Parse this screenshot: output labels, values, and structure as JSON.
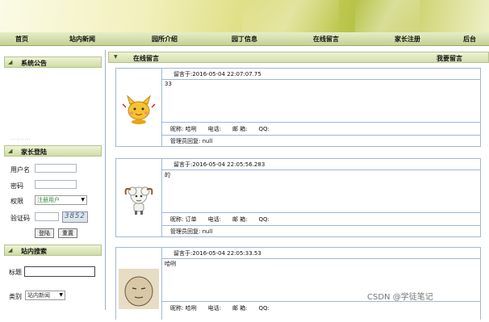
{
  "nav": {
    "items": [
      "首页",
      "站内新闻",
      "园所介绍",
      "园丁信息",
      "在线留言",
      "家长注册",
      "后台"
    ]
  },
  "sidebar": {
    "announcement_title": "系统公告",
    "announcement_text": "· · · · · · · · · ·",
    "login_title": "家长登陆",
    "username_label": "用户名",
    "password_label": "密码",
    "role_label": "权限",
    "role_value": "注册用户",
    "captcha_label": "验证码",
    "captcha_text": "3852",
    "login_button": "登陆",
    "reset_button": "重置",
    "search_title": "站内搜索",
    "search_label": "标题",
    "category_label": "类别",
    "category_value": "站内新闻"
  },
  "main": {
    "title": "在线留言",
    "action": "我要留言"
  },
  "messages": [
    {
      "time": "留言于:2016-05-04 22:07:07.75",
      "content": "33",
      "meta": "昵称: 哈咧　　电话:　　邮 箱:　　QQ:",
      "reply": "管理员回复: null"
    },
    {
      "time": "留言于:2016-05-04 22:05:56.283",
      "content": "的",
      "meta": "昵称: 订单　　电话:　　邮 箱:　　QQ:",
      "reply": "管理员回复: null"
    },
    {
      "time": "留言于:2016-05-04 22:05:33.53",
      "content": "哈咧",
      "meta": "昵称: 哈咧　　电话:　　邮 箱:　　QQ:",
      "reply": ""
    }
  ],
  "watermark": "CSDN @学徒笔记",
  "colors": {
    "nav_bg": "#cfdca4",
    "border": "#9fb9d6",
    "accent": "#3d5a16"
  }
}
